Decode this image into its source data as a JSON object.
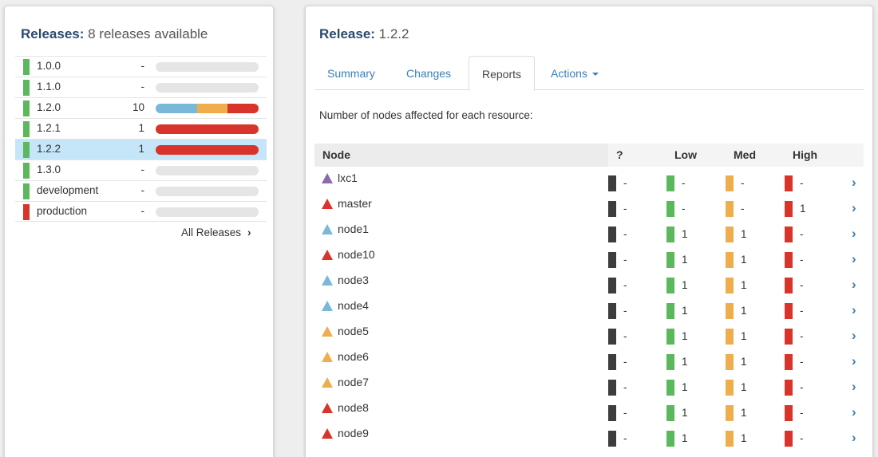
{
  "colors": {
    "green": "#5cb85c",
    "orange": "#f0ad4e",
    "red": "#d9342b",
    "blue": "#7ab8d9",
    "purple": "#8b6aae",
    "dark": "#3d3d3d",
    "track": "#e5e5e5",
    "selected": "#c4e6f8",
    "link": "#3a7fb8"
  },
  "releases_panel": {
    "title_bold": "Releases:",
    "title_rest": " 8 releases available",
    "items": [
      {
        "name": "1.0.0",
        "count": "-",
        "swatch": "#5cb85c",
        "selected": false,
        "segments": []
      },
      {
        "name": "1.1.0",
        "count": "-",
        "swatch": "#5cb85c",
        "selected": false,
        "segments": []
      },
      {
        "name": "1.2.0",
        "count": "10",
        "swatch": "#5cb85c",
        "selected": false,
        "segments": [
          {
            "fraction": 0.4,
            "color": "#7ab8d9"
          },
          {
            "fraction": 0.3,
            "color": "#f0ad4e"
          },
          {
            "fraction": 0.3,
            "color": "#d9342b"
          }
        ]
      },
      {
        "name": "1.2.1",
        "count": "1",
        "swatch": "#5cb85c",
        "selected": false,
        "segments": [
          {
            "fraction": 1.0,
            "color": "#d9342b"
          }
        ]
      },
      {
        "name": "1.2.2",
        "count": "1",
        "swatch": "#5cb85c",
        "selected": true,
        "segments": [
          {
            "fraction": 1.0,
            "color": "#d9342b"
          }
        ]
      },
      {
        "name": "1.3.0",
        "count": "-",
        "swatch": "#5cb85c",
        "selected": false,
        "segments": []
      },
      {
        "name": "development",
        "count": "-",
        "swatch": "#5cb85c",
        "selected": false,
        "segments": []
      },
      {
        "name": "production",
        "count": "-",
        "swatch": "#d9342b",
        "selected": false,
        "segments": []
      }
    ],
    "all_releases_label": "All Releases",
    "all_releases_icon": "chevron-right-icon"
  },
  "release_panel": {
    "title_bold": "Release:",
    "title_rest": " 1.2.2",
    "tabs": [
      {
        "label": "Summary",
        "active": false
      },
      {
        "label": "Changes",
        "active": false
      },
      {
        "label": "Reports",
        "active": true
      },
      {
        "label": "Actions",
        "active": false,
        "dropdown": true
      }
    ],
    "subtitle": "Number of nodes affected for each resource:",
    "table": {
      "headers": {
        "node": "Node",
        "unknown": "?",
        "low": "Low",
        "med": "Med",
        "high": "High"
      },
      "rows": [
        {
          "node": "lxc1",
          "icon": "#8b6aae",
          "unknown": "-",
          "low": "-",
          "med": "-",
          "high": "-"
        },
        {
          "node": "master",
          "icon": "#d9342b",
          "unknown": "-",
          "low": "-",
          "med": "-",
          "high": "1"
        },
        {
          "node": "node1",
          "icon": "#7ab8d9",
          "unknown": "-",
          "low": "1",
          "med": "1",
          "high": "-"
        },
        {
          "node": "node10",
          "icon": "#d9342b",
          "unknown": "-",
          "low": "1",
          "med": "1",
          "high": "-"
        },
        {
          "node": "node3",
          "icon": "#7ab8d9",
          "unknown": "-",
          "low": "1",
          "med": "1",
          "high": "-"
        },
        {
          "node": "node4",
          "icon": "#7ab8d9",
          "unknown": "-",
          "low": "1",
          "med": "1",
          "high": "-"
        },
        {
          "node": "node5",
          "icon": "#f0ad4e",
          "unknown": "-",
          "low": "1",
          "med": "1",
          "high": "-"
        },
        {
          "node": "node6",
          "icon": "#f0ad4e",
          "unknown": "-",
          "low": "1",
          "med": "1",
          "high": "-"
        },
        {
          "node": "node7",
          "icon": "#f0ad4e",
          "unknown": "-",
          "low": "1",
          "med": "1",
          "high": "-"
        },
        {
          "node": "node8",
          "icon": "#d9342b",
          "unknown": "-",
          "low": "1",
          "med": "1",
          "high": "-"
        },
        {
          "node": "node9",
          "icon": "#d9342b",
          "unknown": "-",
          "low": "1",
          "med": "1",
          "high": "-"
        }
      ]
    }
  }
}
